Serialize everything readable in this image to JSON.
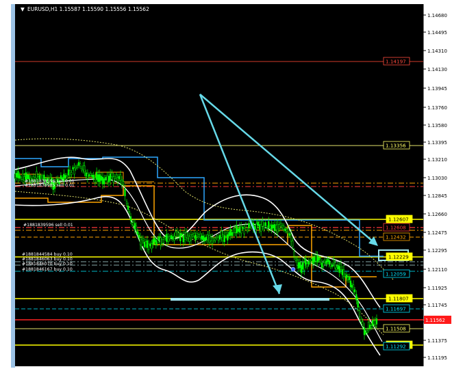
{
  "window": {
    "title": "EURUSD,H1  1.15587 1.15590 1.15556 1.15562",
    "dropdown_icon": "triangle-down-icon"
  },
  "price_axis": {
    "ticks": [
      "1.14680",
      "1.14495",
      "1.14310",
      "1.14130",
      "1.13945",
      "1.13760",
      "1.13580",
      "1.13395",
      "1.13210",
      "1.13030",
      "1.12845",
      "1.12660",
      "1.12475",
      "1.12295",
      "1.12110",
      "1.11925",
      "1.11745",
      "1.11562",
      "1.11375",
      "1.11195"
    ],
    "current_price": "1.11562"
  },
  "level_labels": [
    {
      "text": "1.14197",
      "color": "#ff4a3d",
      "bg": "#000000"
    },
    {
      "text": "1.13356",
      "color": "#ffff66",
      "bg": "#000000"
    },
    {
      "text": "1.12607",
      "color": "#000000",
      "bg": "#ffff00"
    },
    {
      "text": "1.12608",
      "color": "#ff3b3b",
      "bg": "#000000"
    },
    {
      "text": "1.12432",
      "color": "#ffa500",
      "bg": "#000000"
    },
    {
      "text": "1.12229",
      "color": "#000000",
      "bg": "#ffff00"
    },
    {
      "text": "1.12059",
      "color": "#00e5ff",
      "bg": "#000000"
    },
    {
      "text": "1.11807",
      "color": "#000000",
      "bg": "#ffff00"
    },
    {
      "text": "1.11697",
      "color": "#00e5ff",
      "bg": "#000000"
    },
    {
      "text": "1.11508",
      "color": "#ffff66",
      "bg": "#000000"
    },
    {
      "text": "1.11328",
      "color": "#000000",
      "bg": "#ffff00"
    },
    {
      "text": "1.11292",
      "color": "#00e5ff",
      "bg": "#000000"
    }
  ],
  "orders": [
    {
      "text": "#1881838596 sell 0.01"
    },
    {
      "text": "#1881838985 sell 0.01"
    },
    {
      "text": "#1881839596 sell 0.01"
    },
    {
      "text": "#1881844584 buy 0.10"
    },
    {
      "text": "#1881846063 buy 0.10"
    },
    {
      "text": "#1881846070 buy 0.10"
    },
    {
      "text": "#1881846167 buy 0.10"
    }
  ],
  "colors": {
    "chart_bg": "#000000",
    "candles": "#00ff00",
    "bands": "#ffffff",
    "arrows": "#66d9e8",
    "level_yellow": "#ffff00",
    "level_red": "#ff3b3b",
    "level_orange": "#ffa500",
    "channel_blue": "#2ea8ff"
  }
}
